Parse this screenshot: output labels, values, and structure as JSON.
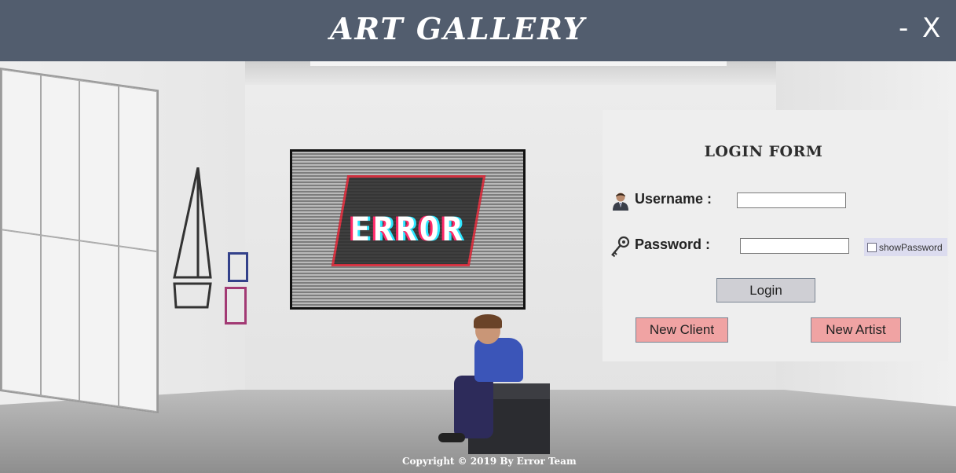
{
  "window": {
    "title": "ART GALLERY",
    "minimize_label": "-",
    "close_label": "X"
  },
  "painting": {
    "text": "ERROR"
  },
  "login": {
    "title": "LOGIN FORM",
    "username_label": "Username :",
    "username_value": "",
    "password_label": "Password :",
    "password_value": "",
    "show_password_label": "showPassword",
    "show_password_checked": false,
    "login_button": "Login",
    "new_client_button": "New Client",
    "new_artist_button": "New Artist"
  },
  "footer": {
    "copyright": "Copyright © 2019 By Error Team"
  },
  "icons": {
    "username": "user-icon",
    "password": "key-icon"
  },
  "colors": {
    "titlebar": "#525d6e",
    "panel": "#eeeeee",
    "accent_button": "#f0a3a3",
    "login_button": "#cfcfd4"
  }
}
